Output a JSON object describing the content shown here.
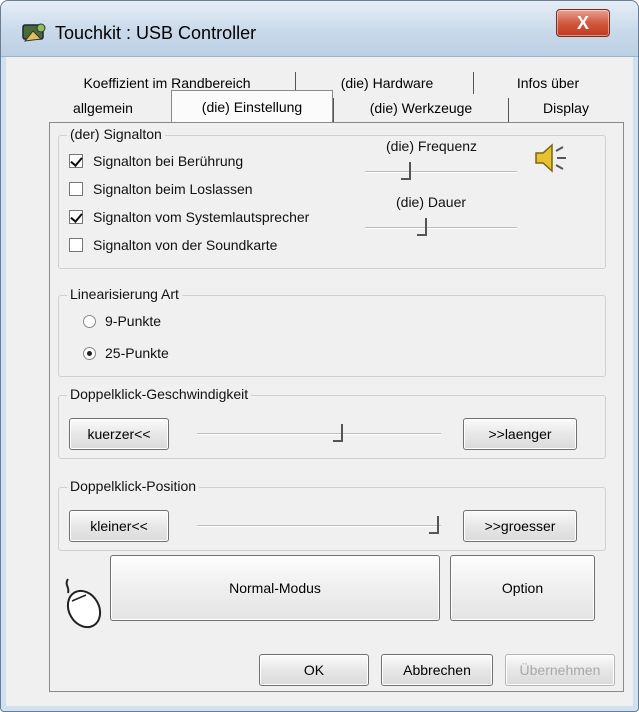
{
  "window": {
    "title": "Touchkit : USB Controller",
    "close_glyph": "X"
  },
  "tabs": {
    "row1": [
      "Koeffizient im Randbereich",
      "(die) Hardware",
      "Infos über"
    ],
    "row2": [
      "allgemein",
      "(die) Einstellung",
      "(die) Werkzeuge",
      "Display"
    ],
    "active": "(die) Einstellung"
  },
  "signalton": {
    "title": "(der) Signalton",
    "options": [
      {
        "label": "Signalton bei Berührung",
        "checked": true
      },
      {
        "label": "Signalton beim Loslassen",
        "checked": false
      },
      {
        "label": "Signalton vom Systemlautsprecher",
        "checked": true
      },
      {
        "label": "Signalton von der Soundkarte",
        "checked": false
      }
    ],
    "frequenz_label": "(die) Frequenz",
    "frequenz_value": 0.3,
    "dauer_label": "(die) Dauer",
    "dauer_value": 0.4,
    "icon": "speaker-icon"
  },
  "linearisierung": {
    "title": "Linearisierung Art",
    "options": [
      {
        "label": "9-Punkte",
        "selected": false
      },
      {
        "label": "25-Punkte",
        "selected": true
      }
    ]
  },
  "doppelklick_speed": {
    "title": "Doppelklick-Geschwindigkeit",
    "decrease": "kuerzer<<",
    "increase": ">>laenger",
    "value": 0.6
  },
  "doppelklick_position": {
    "title": "Doppelklick-Position",
    "decrease": "kleiner<<",
    "increase": ">>groesser",
    "value": 1.0
  },
  "mode": {
    "icon": "mouse-icon",
    "normal": "Normal-Modus",
    "option": "Option"
  },
  "footer": {
    "ok": "OK",
    "cancel": "Abbrechen",
    "apply": "Übernehmen"
  }
}
